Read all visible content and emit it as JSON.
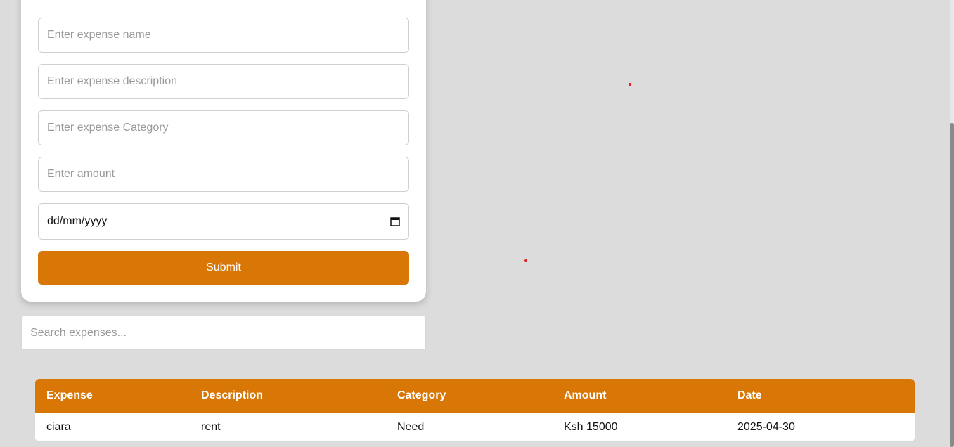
{
  "form": {
    "name_placeholder": "Enter expense name",
    "description_placeholder": "Enter expense description",
    "category_placeholder": "Enter expense Category",
    "amount_placeholder": "Enter amount",
    "date_placeholder": "dd/mm/yyyy",
    "submit_label": "Submit"
  },
  "search": {
    "placeholder": "Search expenses..."
  },
  "table": {
    "headers": [
      "Expense",
      "Description",
      "Category",
      "Amount",
      "Date"
    ],
    "rows": [
      [
        "ciara",
        "rent",
        "Need",
        "Ksh 15000",
        "2025-04-30"
      ]
    ]
  },
  "colors": {
    "accent": "#d97706",
    "background": "#dcdcdc",
    "dot": "#e01b1b"
  },
  "icons": {
    "date_picker": "calendar-icon"
  }
}
